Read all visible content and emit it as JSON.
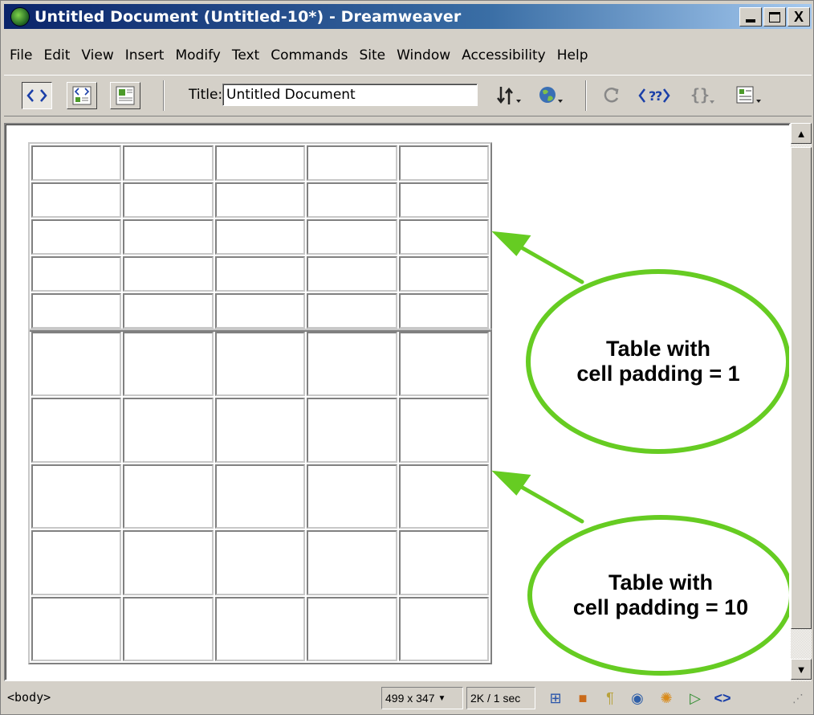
{
  "window": {
    "title": "Untitled Document (Untitled-10*) - Dreamweaver",
    "minimize_label": "_",
    "close_label": "X"
  },
  "menu": [
    "File",
    "Edit",
    "View",
    "Insert",
    "Modify",
    "Text",
    "Commands",
    "Site",
    "Window",
    "Accessibility",
    "Help"
  ],
  "toolbar": {
    "title_label": "Title:",
    "title_value": "Untitled Document",
    "icons": [
      "code-view-icon",
      "split-view-icon",
      "design-view-icon",
      "file-management-icon",
      "preview-browser-icon",
      "refresh-icon",
      "reference-icon",
      "code-navigation-icon",
      "view-options-icon"
    ]
  },
  "document": {
    "table_small": {
      "rows": 5,
      "cols": 5,
      "cell_padding": 1
    },
    "table_large": {
      "rows": 5,
      "cols": 5,
      "cell_padding": 10
    }
  },
  "callouts": {
    "small": "Table with\ncell padding = 1",
    "large": "Table with\ncell padding = 10",
    "color": "#66cc22"
  },
  "status": {
    "tag": "<body>",
    "dimensions": "499 x 347",
    "download": "2K / 1 sec"
  }
}
